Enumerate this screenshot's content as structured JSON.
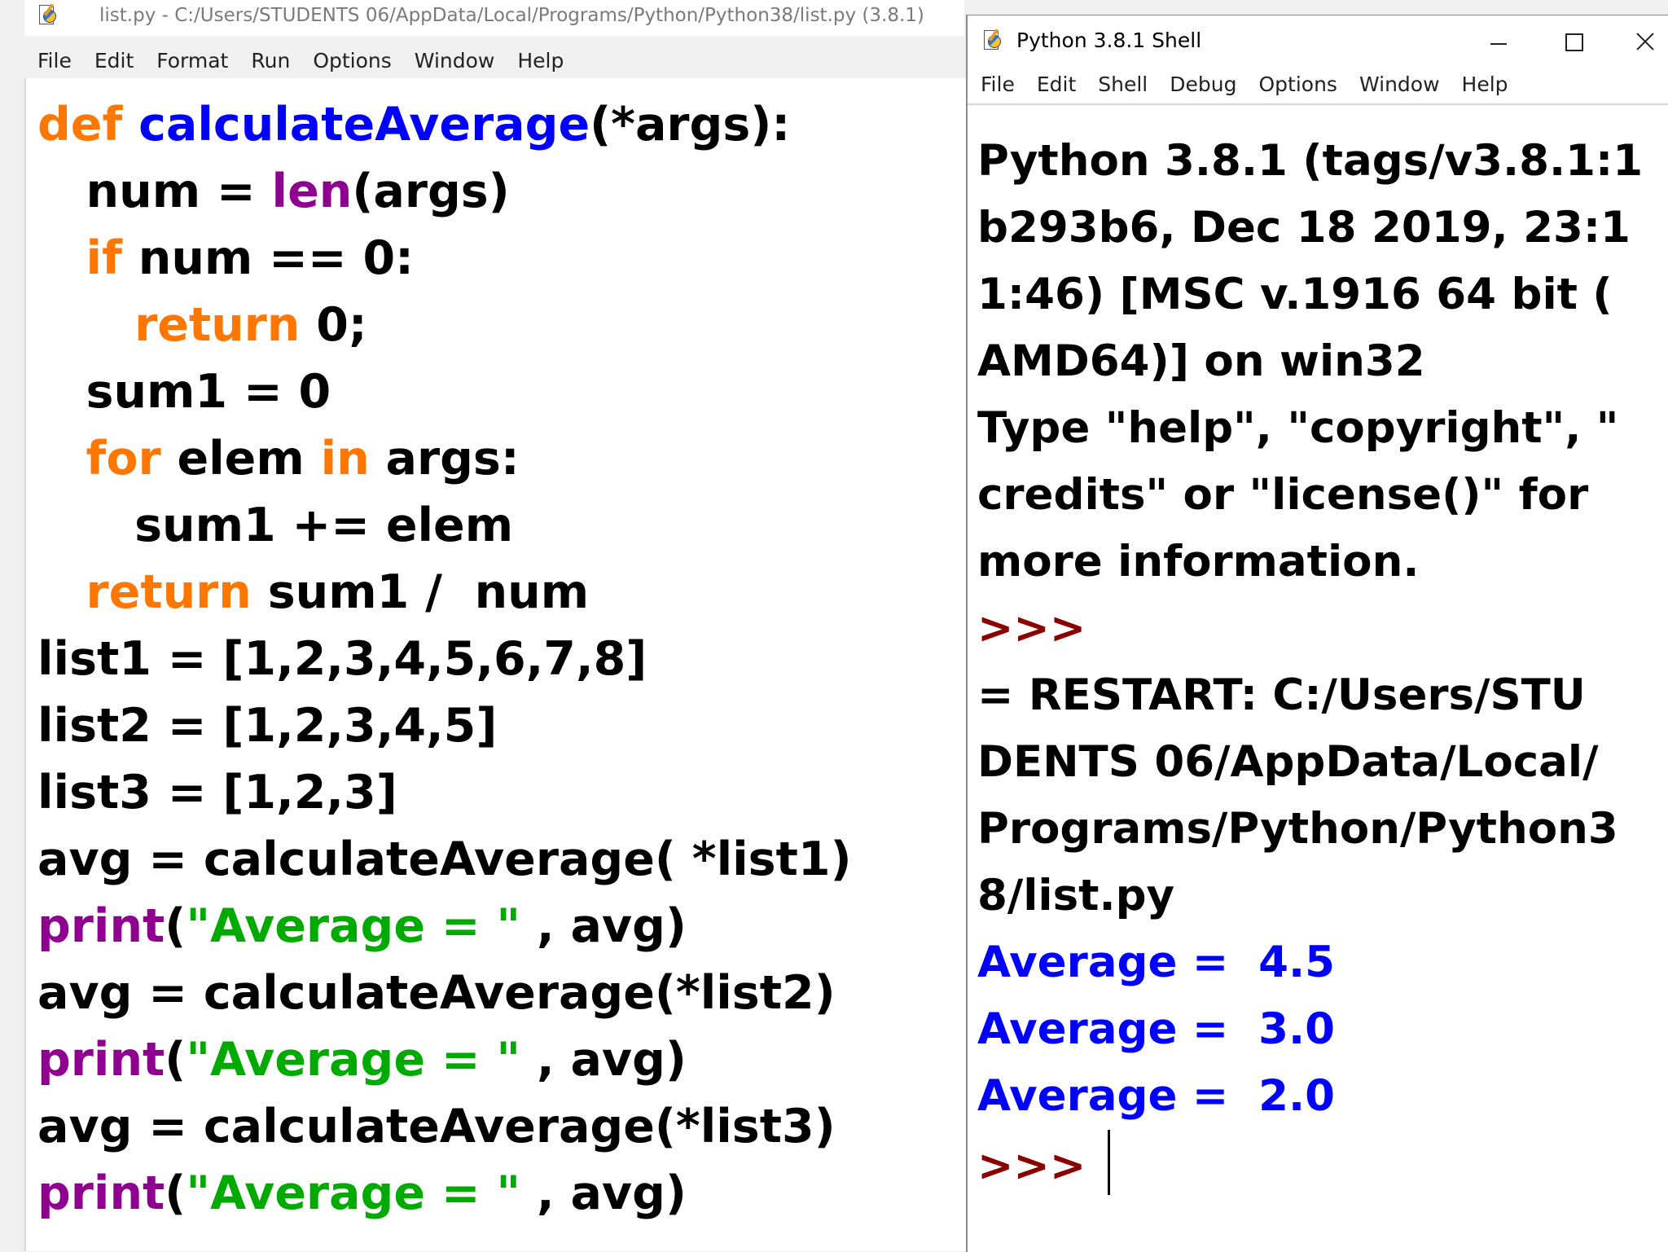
{
  "editor": {
    "title": "list.py - C:/Users/STUDENTS 06/AppData/Local/Programs/Python/Python38/list.py (3.8.1)",
    "menu": [
      "File",
      "Edit",
      "Format",
      "Run",
      "Options",
      "Window",
      "Help"
    ],
    "code_lines": [
      [
        {
          "t": "def ",
          "c": "kw"
        },
        {
          "t": "calculateAverage",
          "c": "fn"
        },
        {
          "t": "(*args):",
          "c": ""
        }
      ],
      [
        {
          "t": "   num = ",
          "c": ""
        },
        {
          "t": "len",
          "c": "bi"
        },
        {
          "t": "(args)",
          "c": ""
        }
      ],
      [
        {
          "t": "   ",
          "c": ""
        },
        {
          "t": "if",
          "c": "kw"
        },
        {
          "t": " num == 0:",
          "c": ""
        }
      ],
      [
        {
          "t": "      ",
          "c": ""
        },
        {
          "t": "return",
          "c": "kw"
        },
        {
          "t": " 0;",
          "c": ""
        }
      ],
      [
        {
          "t": "   sum1 = 0",
          "c": ""
        }
      ],
      [
        {
          "t": "   ",
          "c": ""
        },
        {
          "t": "for",
          "c": "kw"
        },
        {
          "t": " elem ",
          "c": ""
        },
        {
          "t": "in",
          "c": "kw"
        },
        {
          "t": " args:",
          "c": ""
        }
      ],
      [
        {
          "t": "      sum1 += elem",
          "c": ""
        }
      ],
      [
        {
          "t": "   ",
          "c": ""
        },
        {
          "t": "return",
          "c": "kw"
        },
        {
          "t": " sum1 /  num",
          "c": ""
        }
      ],
      [
        {
          "t": "list1 = [1,2,3,4,5,6,7,8]",
          "c": ""
        }
      ],
      [
        {
          "t": "list2 = [1,2,3,4,5]",
          "c": ""
        }
      ],
      [
        {
          "t": "list3 = [1,2,3]",
          "c": ""
        }
      ],
      [
        {
          "t": "avg = calculateAverage( *list1)",
          "c": ""
        }
      ],
      [
        {
          "t": "print",
          "c": "bi"
        },
        {
          "t": "(",
          "c": ""
        },
        {
          "t": "\"Average = \"",
          "c": "st"
        },
        {
          "t": " , avg)",
          "c": ""
        }
      ],
      [
        {
          "t": "avg = calculateAverage(*list2)",
          "c": ""
        }
      ],
      [
        {
          "t": "print",
          "c": "bi"
        },
        {
          "t": "(",
          "c": ""
        },
        {
          "t": "\"Average = \"",
          "c": "st"
        },
        {
          "t": " , avg)",
          "c": ""
        }
      ],
      [
        {
          "t": "avg = calculateAverage(*list3)",
          "c": ""
        }
      ],
      [
        {
          "t": "print",
          "c": "bi"
        },
        {
          "t": "(",
          "c": ""
        },
        {
          "t": "\"Average = \"",
          "c": "st"
        },
        {
          "t": " , avg)",
          "c": ""
        }
      ]
    ]
  },
  "shell": {
    "title": "Python 3.8.1 Shell",
    "menu": [
      "File",
      "Edit",
      "Shell",
      "Debug",
      "Options",
      "Window",
      "Help"
    ],
    "output_lines": [
      [
        {
          "t": "Python 3.8.1 (tags/v3.8.1:1",
          "c": ""
        }
      ],
      [
        {
          "t": "b293b6, Dec 18 2019, 23:1",
          "c": ""
        }
      ],
      [
        {
          "t": "1:46) [MSC v.1916 64 bit (",
          "c": ""
        }
      ],
      [
        {
          "t": "AMD64)] on win32",
          "c": ""
        }
      ],
      [
        {
          "t": "Type \"help\", \"copyright\", \"",
          "c": ""
        }
      ],
      [
        {
          "t": "credits\" or \"license()\" for",
          "c": ""
        }
      ],
      [
        {
          "t": "more information.",
          "c": ""
        }
      ],
      [
        {
          "t": ">>>",
          "c": "prompt"
        }
      ],
      [
        {
          "t": "= RESTART: C:/Users/STU",
          "c": ""
        }
      ],
      [
        {
          "t": "DENTS 06/AppData/Local/",
          "c": ""
        }
      ],
      [
        {
          "t": "Programs/Python/Python3",
          "c": ""
        }
      ],
      [
        {
          "t": "8/list.py",
          "c": ""
        }
      ],
      [
        {
          "t": "Average =  4.5",
          "c": "out"
        }
      ],
      [
        {
          "t": "Average =  3.0",
          "c": "out"
        }
      ],
      [
        {
          "t": "Average =  2.0",
          "c": "out"
        }
      ],
      [
        {
          "t": ">>>",
          "c": "prompt"
        },
        {
          "t": " ",
          "c": ""
        }
      ]
    ]
  },
  "colors": {
    "keyword": "#ff7700",
    "function_name": "#0000ff",
    "builtin": "#900090",
    "string": "#00aa00",
    "prompt": "#880000",
    "stdout": "#0000ff"
  },
  "icons": {
    "editor": "idle-file-icon",
    "shell": "idle-shell-icon",
    "minimize": "minimize-icon",
    "maximize": "maximize-icon",
    "close": "close-icon"
  }
}
